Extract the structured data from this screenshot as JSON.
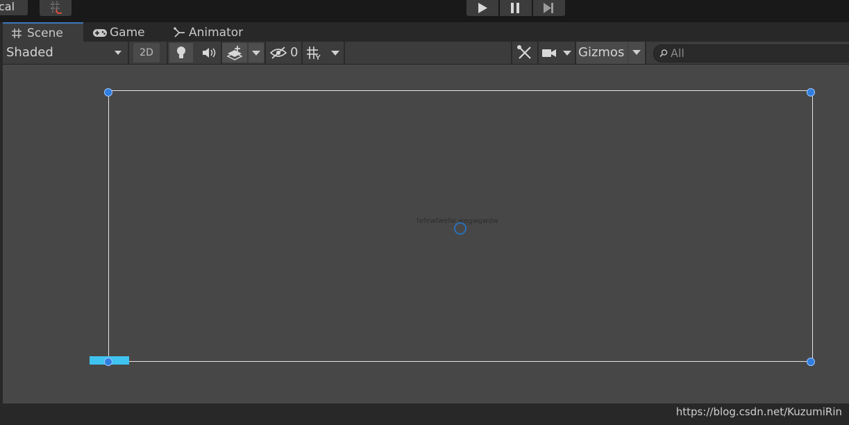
{
  "toolbar": {
    "local_label": "cal",
    "play_icon": "play-icon",
    "pause_icon": "pause-icon",
    "step_icon": "step-icon"
  },
  "tabs": [
    {
      "label": "Scene",
      "icon": "grid-icon",
      "active": true
    },
    {
      "label": "Game",
      "icon": "gamepad-icon",
      "active": false
    },
    {
      "label": "Animator",
      "icon": "animator-icon",
      "active": false
    }
  ],
  "scene_toolbar": {
    "draw_mode": "Shaded",
    "mode_2d": "2D",
    "hidden_count": "0",
    "gizmos": "Gizmos",
    "search_placeholder": "All"
  },
  "scene": {
    "center_text": "fefewfwefw wegwgwdw"
  },
  "watermark": "https://blog.csdn.net/KuzumiRin",
  "colors": {
    "accent": "#3a79bb",
    "handle": "#2f7ee0",
    "selection": "#3fc3f0"
  }
}
